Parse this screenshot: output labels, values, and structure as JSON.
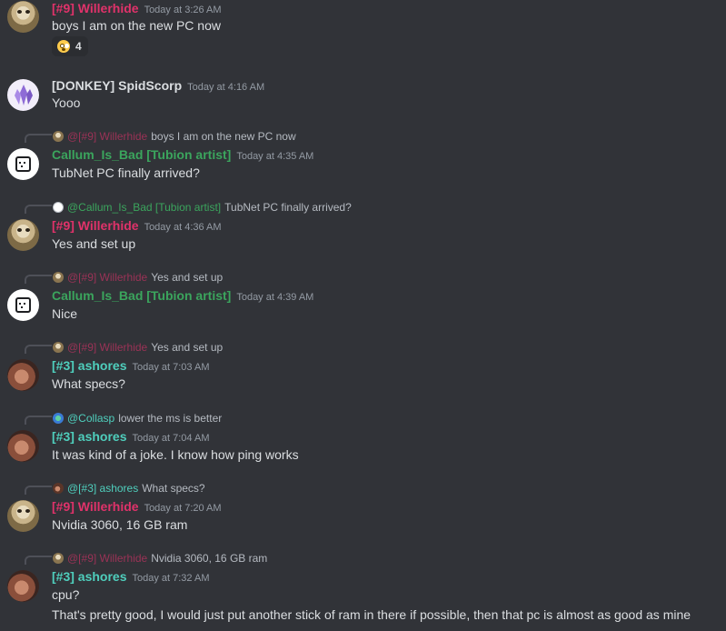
{
  "colors": {
    "background": "#313338",
    "willerhide": "#e0326a",
    "donkey": "#dbdee1",
    "callum": "#3ba55d",
    "ashores": "#4fcfbd",
    "collasp": "#4fcfbd",
    "timestamp": "#949ba4",
    "reply_text": "#b5bac1"
  },
  "messages": [
    {
      "author": "[#9] Willerhide",
      "time": "Today at 3:26 AM",
      "text": "boys I am on the new PC now",
      "reaction": {
        "emoji": "flushed-face",
        "count": "4"
      }
    },
    {
      "author": "[DONKEY] SpidScorp",
      "time": "Today at 4:16 AM",
      "text": "Yooo"
    },
    {
      "reply": {
        "name": "@[#9] Willerhide",
        "text": "boys I am on the new PC now"
      },
      "author": "Callum_Is_Bad [Tubion artist]",
      "time": "Today at 4:35 AM",
      "text": "TubNet PC finally arrived?"
    },
    {
      "reply": {
        "name": "@Callum_Is_Bad [Tubion artist]",
        "text": "TubNet PC finally arrived?"
      },
      "author": "[#9] Willerhide",
      "time": "Today at 4:36 AM",
      "text": "Yes and set up"
    },
    {
      "reply": {
        "name": "@[#9] Willerhide",
        "text": "Yes and set up"
      },
      "author": "Callum_Is_Bad [Tubion artist]",
      "time": "Today at 4:39 AM",
      "text": "Nice"
    },
    {
      "reply": {
        "name": "@[#9] Willerhide",
        "text": "Yes and set up"
      },
      "author": "[#3] ashores",
      "time": "Today at 7:03 AM",
      "text": "What specs?"
    },
    {
      "reply": {
        "name": "@Collasp",
        "text": "lower the ms is better"
      },
      "author": "[#3] ashores",
      "time": "Today at 7:04 AM",
      "text": "It was kind of a joke. I know how ping works"
    },
    {
      "reply": {
        "name": "@[#3] ashores",
        "text": "What specs?"
      },
      "author": "[#9] Willerhide",
      "time": "Today at 7:20 AM",
      "text": "Nvidia 3060, 16 GB ram"
    },
    {
      "reply": {
        "name": "@[#9] Willerhide",
        "text": "Nvidia 3060, 16 GB ram"
      },
      "author": "[#3] ashores",
      "time": "Today at 7:32 AM",
      "text": "cpu?",
      "text2": "That's pretty good, I would just put another stick of ram in there if possible, then that pc is almost as good as mine"
    }
  ]
}
